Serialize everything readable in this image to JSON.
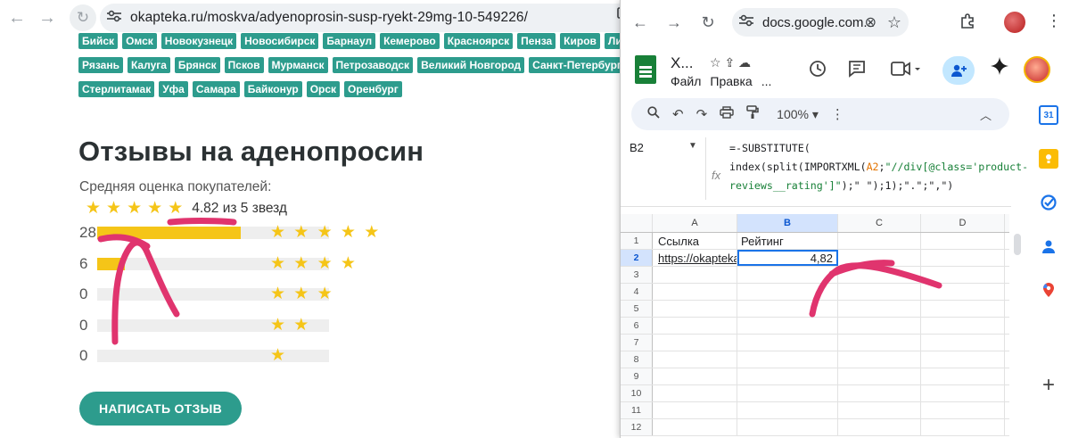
{
  "left_browser": {
    "back_glyph": "←",
    "forward_glyph": "→",
    "refresh_glyph": "↻",
    "url": "okapteka.ru/moskva/adyenoprosin-susp-ryekt-29mg-10-549226/",
    "icons": [
      "back-arrow-icon",
      "forward-arrow-icon",
      "reload-icon",
      "site-settings-icon",
      "cast-icon"
    ]
  },
  "cities": {
    "row1": [
      "Бийск",
      "Омск",
      "Новокузнецк",
      "Новосибирск",
      "Барнаул",
      "Кемерово",
      "Красноярск",
      "Пенза",
      "Киров",
      "Ли"
    ],
    "row2": [
      "Рязань",
      "Калуга",
      "Брянск",
      "Псков",
      "Мурманск",
      "Петрозаводск",
      "Великий Новгород",
      "Санкт-Петербург"
    ],
    "row3": [
      "Стерлитамак",
      "Уфа",
      "Самара",
      "Байконур",
      "Орск",
      "Оренбург"
    ]
  },
  "reviews": {
    "title": "Отзывы на аденопросин",
    "avg_label": "Средняя оценка покупателей:",
    "avg_text": "4.82 из 5 звезд",
    "avg_stars": 5,
    "distribution": [
      {
        "count": "28",
        "stars": "★ ★ ★ ★ ★",
        "fraction": 0.62
      },
      {
        "count": "6",
        "stars": "★ ★ ★ ★",
        "fraction": 0.12
      },
      {
        "count": "0",
        "stars": "★ ★ ★",
        "fraction": 0
      },
      {
        "count": "0",
        "stars": "★ ★",
        "fraction": 0
      },
      {
        "count": "0",
        "stars": "★",
        "fraction": 0
      }
    ],
    "write_button": "НАПИСАТЬ ОТЗЫВ",
    "star_color": "#f5c518"
  },
  "right_browser": {
    "back_glyph": "←",
    "forward_glyph": "→",
    "refresh_glyph": "↻",
    "url": "docs.google.com...",
    "close_glyph": "⊗",
    "star_glyph": "☆",
    "icons": [
      "back-arrow-icon",
      "forward-arrow-icon",
      "reload-icon",
      "clear-icon",
      "bookmark-star-icon",
      "extensions-icon",
      "profile-avatar",
      "kebab-menu-icon"
    ]
  },
  "sheets": {
    "title": "Х...",
    "title_icons": "☆  ⇪  ☁",
    "menu": [
      "Файл",
      "Правка",
      "..."
    ],
    "header_icons": [
      "history-icon",
      "comment-icon",
      "meet-icon",
      "share-icon",
      "gemini-icon",
      "account-avatar"
    ],
    "toolbar": {
      "zoom": "100%",
      "icons": [
        "search-icon",
        "undo-icon",
        "redo-icon",
        "print-icon",
        "paint-format-icon",
        "more-icon",
        "collapse-icon"
      ]
    },
    "cell_ref": "B2",
    "fx": "fx",
    "formula": {
      "line1": "=-SUBSTITUTE(",
      "line2_a": "index(split(IMPORTXML(",
      "line2_ref": "A2",
      "line2_b": ";",
      "line2_str": "\"//div[@class='product-",
      "line3_str": "reviews__rating']\"",
      "line3_rest": ");\" \");1);\".\";\",\")"
    },
    "columns": [
      "A",
      "B",
      "C",
      "D"
    ],
    "rows": [
      {
        "n": "1",
        "a": "Ссылка",
        "b": "Рейтинг"
      },
      {
        "n": "2",
        "a": "https://okapteka.",
        "b": "4,82"
      },
      {
        "n": "3"
      },
      {
        "n": "4"
      },
      {
        "n": "5"
      },
      {
        "n": "6"
      },
      {
        "n": "7"
      },
      {
        "n": "8"
      },
      {
        "n": "9"
      },
      {
        "n": "10"
      },
      {
        "n": "11"
      },
      {
        "n": "12"
      }
    ],
    "side_panel": {
      "calendar": "31",
      "icons": [
        "calendar-icon",
        "keep-icon",
        "tasks-icon",
        "contacts-icon",
        "maps-icon",
        "add-addon-icon"
      ]
    }
  },
  "annotation_color": "#e0346e"
}
